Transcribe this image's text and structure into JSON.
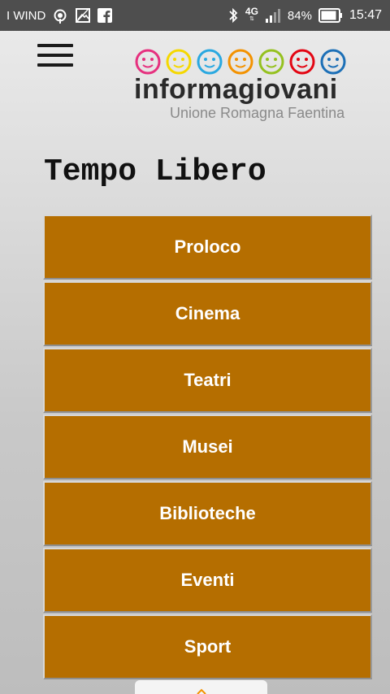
{
  "status_bar": {
    "carrier": "I WIND",
    "network": "4G",
    "battery": "84%",
    "time": "15:47"
  },
  "logo": {
    "word": "informagiovani",
    "subtitle": "Unione Romagna Faentina",
    "face_colors": [
      "#e6317f",
      "#f5d800",
      "#2aa8e0",
      "#f39200",
      "#95c11f",
      "#e30613",
      "#1d70b7"
    ]
  },
  "page": {
    "title": "Tempo Libero"
  },
  "menu": {
    "items": [
      {
        "label": "Proloco"
      },
      {
        "label": "Cinema"
      },
      {
        "label": "Teatri"
      },
      {
        "label": "Musei"
      },
      {
        "label": "Biblioteche"
      },
      {
        "label": "Eventi"
      },
      {
        "label": "Sport"
      }
    ]
  },
  "colors": {
    "button_bg": "#b56e00",
    "status_bar_bg": "#4e4e4e",
    "accent_chevron": "#f39200"
  }
}
